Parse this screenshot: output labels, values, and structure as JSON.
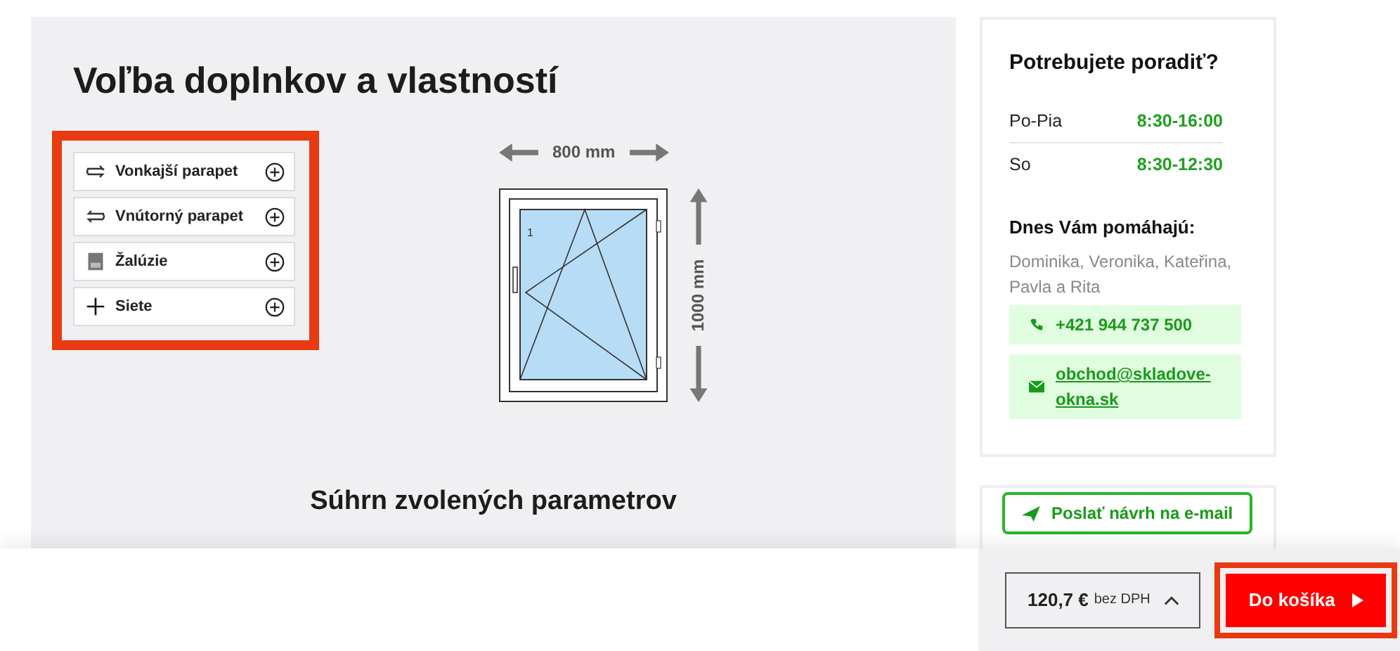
{
  "heading": "Voľba doplnkov a vlastností",
  "options": [
    {
      "kind": "sill-out",
      "label": "Vonkajší parapet"
    },
    {
      "kind": "sill-in",
      "label": "Vnútorný parapet"
    },
    {
      "kind": "blind",
      "label": "Žalúzie"
    },
    {
      "kind": "screen",
      "label": "Siete"
    }
  ],
  "window": {
    "width_label": "800 mm",
    "height_label": "1000 mm",
    "sash_number": "1"
  },
  "summary_title": "Súhrn zvolených parametrov",
  "help": {
    "title": "Potrebujete poradiť?",
    "hours": [
      {
        "days": "Po-Pia",
        "time": "8:30-16:00"
      },
      {
        "days": "So",
        "time": "8:30-12:30"
      }
    ],
    "team_title": "Dnes Vám pomáhajú:",
    "team": "Dominika, Veronika, Kateřina, Pavla a Rita",
    "phone": "+421 944 737 500",
    "email": "obchod@skladove-okna.sk"
  },
  "send_button": "Poslať návrh na e-mail",
  "price": {
    "amount": "120,7 €",
    "note": "bez DPH"
  },
  "cart_button": "Do košíka"
}
